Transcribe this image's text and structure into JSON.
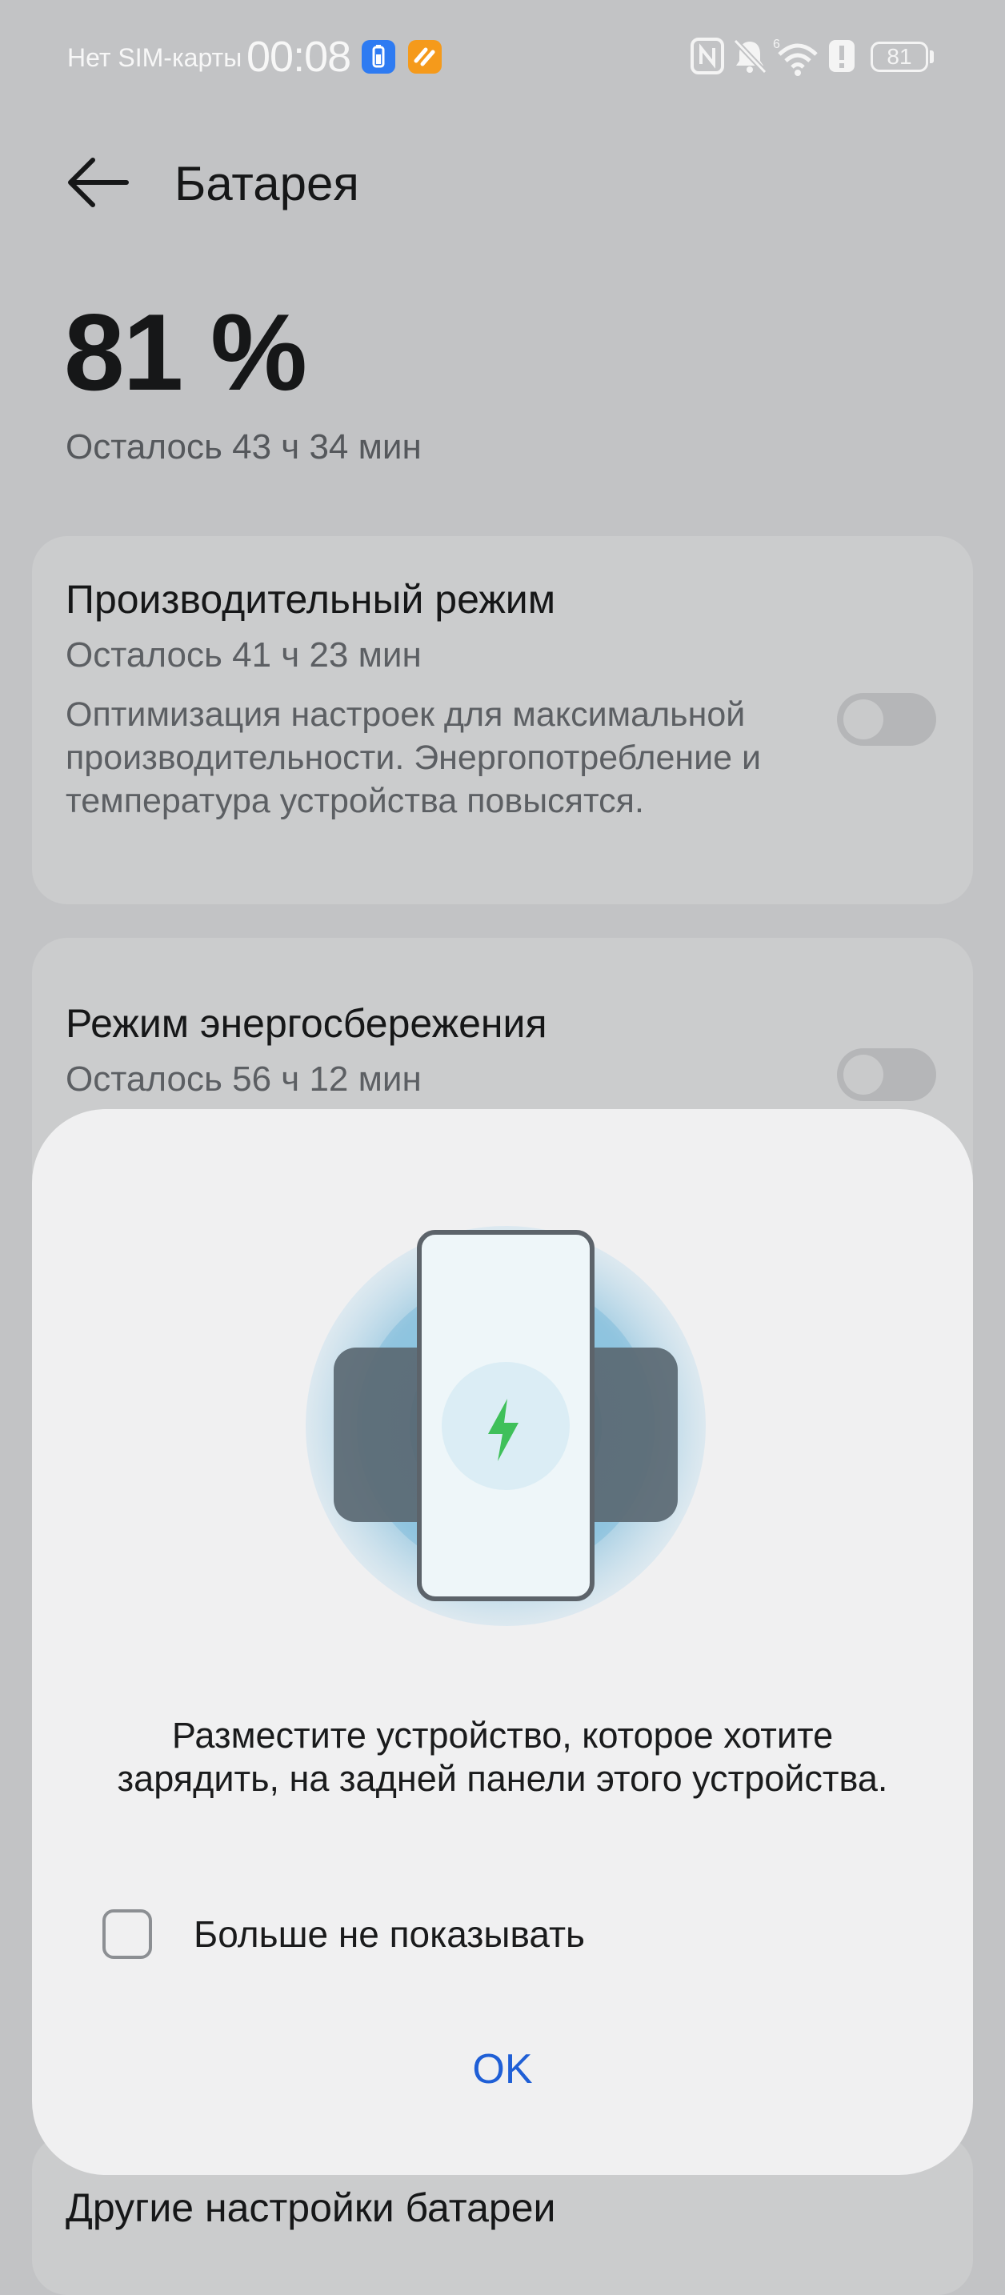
{
  "status_bar": {
    "sim": "Нет SIM-карты",
    "time": "00:08",
    "battery_level": "81",
    "icons": [
      "nfc-icon",
      "bell-muted-icon",
      "wifi-icon",
      "alert-icon",
      "battery-icon"
    ]
  },
  "header": {
    "back_icon": "arrow-left-icon",
    "title": "Батарея"
  },
  "summary": {
    "percent": "81 %",
    "remaining": "Осталось 43 ч 34 мин"
  },
  "performance_mode": {
    "title": "Производительный режим",
    "remaining": "Осталось 41 ч 23 мин",
    "description": "Оптимизация настроек для максимальной производительности. Энергопотребление и температура устройства повысятся.",
    "enabled": false
  },
  "power_saving_mode": {
    "title": "Режим энергосбережения",
    "remaining": "Осталось 56 ч 12 мин",
    "enabled": false
  },
  "other_settings": {
    "label": "Другие настройки батареи"
  },
  "dialog": {
    "illustration": "reverse-wireless-charging-illustration",
    "message": "Разместите устройство, которое хотите зарядить, на задней панели этого устройства.",
    "checkbox_label": "Больше не показывать",
    "checkbox_checked": false,
    "ok_label": "OK"
  },
  "colors": {
    "accent": "#1f5fd6",
    "charge_bolt": "#3fc05a",
    "app_badge_blue": "#2e7bf2",
    "app_badge_orange": "#f59a1b"
  }
}
